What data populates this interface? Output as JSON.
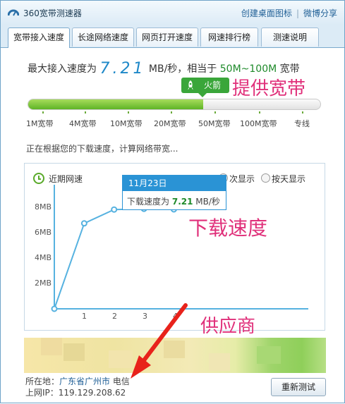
{
  "window": {
    "title": "360宽带测速器",
    "top_links": [
      "创建桌面图标",
      "微博分享"
    ],
    "separator": "|"
  },
  "tabs": [
    {
      "label": "宽带接入速度",
      "active": true
    },
    {
      "label": "长途网络速度",
      "active": false
    },
    {
      "label": "网页打开速度",
      "active": false
    },
    {
      "label": "网速排行榜",
      "active": false
    },
    {
      "label": "测速说明",
      "active": false
    }
  ],
  "result": {
    "prefix": "最大接入速度为",
    "speed": "7.21",
    "unit": "MB/秒，相当于",
    "range": "50M~100M",
    "suffix": "宽带"
  },
  "rocket": {
    "label": "火箭",
    "icon": "rocket-icon"
  },
  "annotations": {
    "provide_bandwidth": "提供宽带",
    "download_speed": "下载速度",
    "provider": "供应商"
  },
  "progress": {
    "fraction": 0.6
  },
  "scale_labels": [
    "1M宽带",
    "4M宽带",
    "10M宽带",
    "20M宽带",
    "50M宽带",
    "100M宽带",
    "专线"
  ],
  "status_text": "正在根据您的下载速度，计算网络带宽...",
  "panel": {
    "title": "近期网速",
    "radio1": "次显示",
    "radio2": "按天显示"
  },
  "tooltip": {
    "date": "11月23日",
    "prefix": "下载速度为",
    "value": "7.21",
    "unit": "MB/秒"
  },
  "chart_data": {
    "type": "line",
    "title": "近期网速",
    "x": [
      0,
      1,
      2,
      3,
      4
    ],
    "y": [
      0,
      6.2,
      7.2,
      7.25,
      7.21
    ],
    "x_ticks": [
      "1",
      "2",
      "3",
      "4"
    ],
    "y_ticks": [
      "2MB",
      "4MB",
      "6MB",
      "8MB"
    ],
    "ylim": [
      0,
      9
    ],
    "xlim": [
      0,
      8.5
    ],
    "color": "#56b2e0"
  },
  "footer": {
    "location_label": "所在地：",
    "location": "广东省广州市",
    "isp": "电信",
    "ip_label": "上网IP：",
    "ip": "119.129.208.62",
    "retest_label": "重新测试"
  },
  "colors": {
    "accent": "#2a93d5",
    "green": "#5fb426",
    "annotation": "#e0307a"
  }
}
